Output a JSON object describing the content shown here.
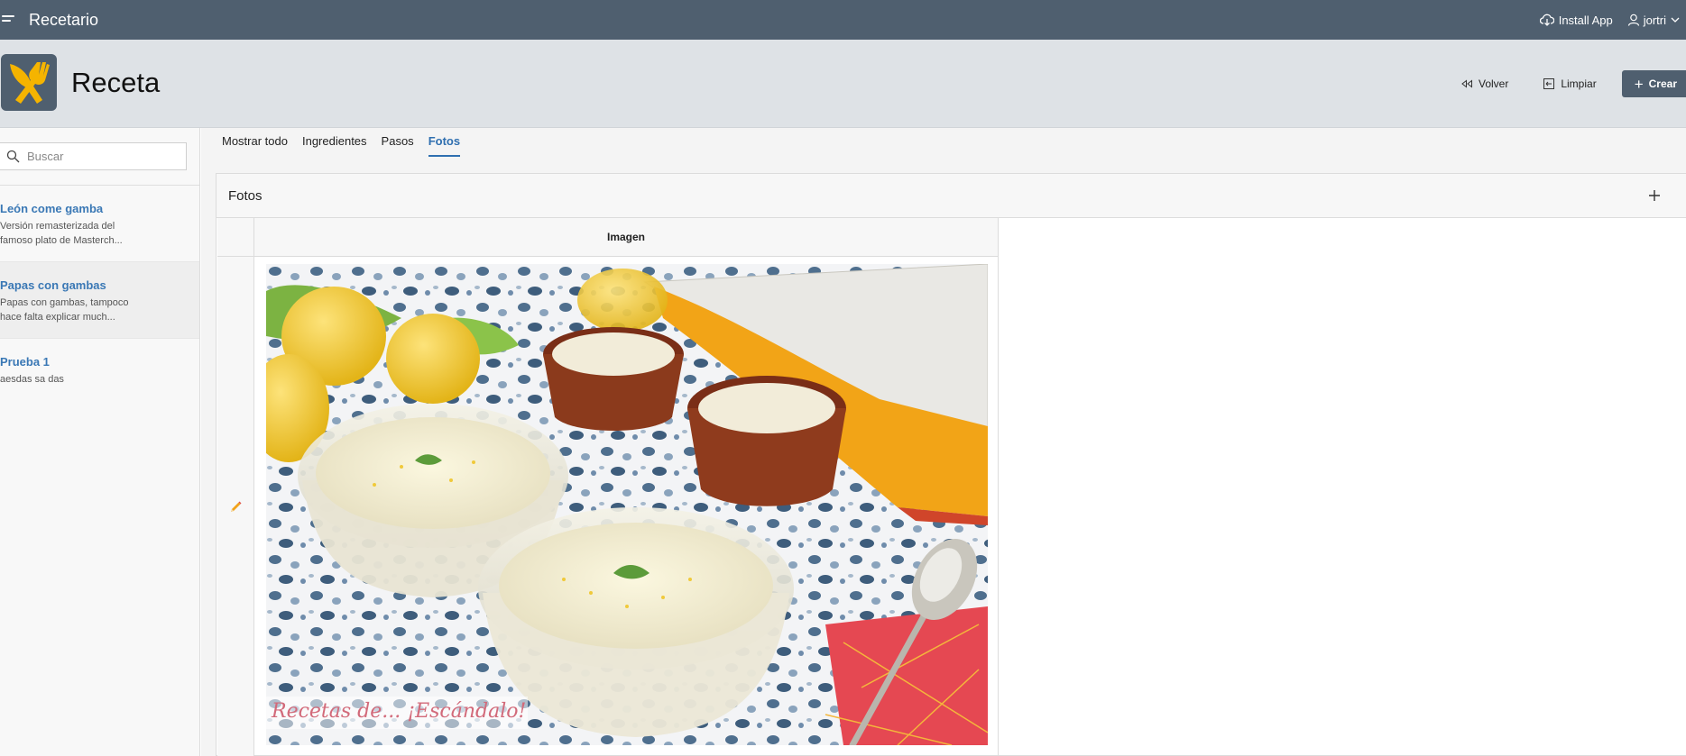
{
  "app": {
    "title": "Recetario"
  },
  "topbar": {
    "install_label": "Install App",
    "user_name": "jortri"
  },
  "header": {
    "page_title": "Receta",
    "back_label": "Volver",
    "clear_label": "Limpiar",
    "create_label": "Crear"
  },
  "sidebar": {
    "search_placeholder": "Buscar",
    "items": [
      {
        "name": "León come gamba",
        "desc": "Versión remasterizada del famoso plato de Masterch..."
      },
      {
        "name": "Papas con gambas",
        "desc": "Papas con gambas, tampoco hace falta explicar much..."
      },
      {
        "name": "Prueba 1",
        "desc": "aesdas sa das"
      }
    ]
  },
  "tabs": [
    {
      "label": "Mostrar todo"
    },
    {
      "label": "Ingredientes"
    },
    {
      "label": "Pasos"
    },
    {
      "label": "Fotos",
      "active": true
    }
  ],
  "region": {
    "title": "Fotos",
    "column_header": "Imagen",
    "photo_watermark": "Recetas de... ¡Escándalo!"
  },
  "colors": {
    "topbar": "#4f5f6f",
    "header": "#dee2e6",
    "link": "#3a78b5",
    "logo_fork": "#f5b400"
  },
  "icons": [
    "menu-icon",
    "cloud-download-icon",
    "user-icon",
    "chevron-down-icon",
    "rewind-icon",
    "clear-icon",
    "plus-icon",
    "search-icon",
    "pencil-icon"
  ]
}
